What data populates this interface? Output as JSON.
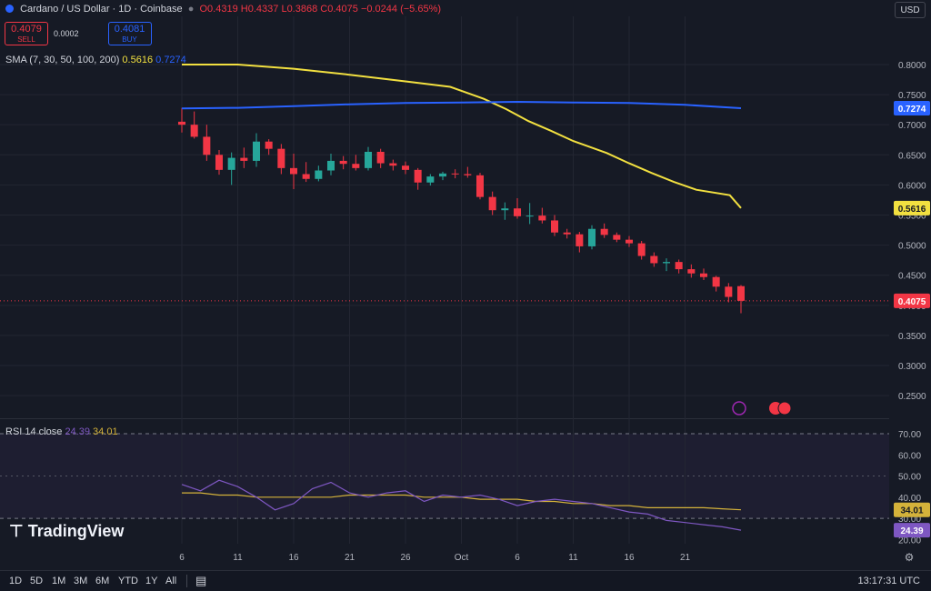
{
  "header": {
    "title": "Cardano / US Dollar · 1D · Coinbase",
    "ohlc_open_label": "O",
    "ohlc_open": "0.4319",
    "ohlc_high_label": "H",
    "ohlc_high": "0.4337",
    "ohlc_low_label": "L",
    "ohlc_low": "0.3868",
    "ohlc_close_label": "C",
    "ohlc_close": "0.4075",
    "change": "−0.0244 (−5.65%)"
  },
  "trade": {
    "sell_price": "0.4079",
    "sell_label": "SELL",
    "spread": "0.0002",
    "buy_price": "0.4081",
    "buy_label": "BUY"
  },
  "currency": "USD",
  "sma_legend": {
    "label": "SMA (7, 30, 50, 100, 200)",
    "v1": "0.5616",
    "v2": "0.7274"
  },
  "rsi_legend": {
    "label": "RSI 14 close",
    "v1": "24.39",
    "v2": "34.01"
  },
  "watermark": "TradingView",
  "bottom": {
    "timeframes": [
      "1D",
      "5D",
      "1M",
      "3M",
      "6M",
      "YTD",
      "1Y",
      "All"
    ],
    "clock": "13:17:31 UTC"
  },
  "colors": {
    "up": "#26a69a",
    "down": "#f23645",
    "sma_short": "#f2e040",
    "sma_long": "#2962ff",
    "rsi": "#7e57c2",
    "rsi_ma": "#d4b23a"
  },
  "chart_data": [
    {
      "type": "candlestick",
      "title": "Cardano / US Dollar · 1D · Coinbase",
      "ylim": [
        0.22,
        0.88
      ],
      "yticks": [
        "0.8000",
        "0.7500",
        "0.7000",
        "0.6500",
        "0.6000",
        "0.5500",
        "0.5000",
        "0.4500",
        "0.4000",
        "0.3500",
        "0.3000",
        "0.2500"
      ],
      "ytick_values": [
        0.8,
        0.75,
        0.7,
        0.65,
        0.6,
        0.55,
        0.5,
        0.45,
        0.4,
        0.35,
        0.3,
        0.25
      ],
      "xlim": [
        0,
        50
      ],
      "xticks": [
        {
          "label": "6",
          "x": 0
        },
        {
          "label": "11",
          "x": 5
        },
        {
          "label": "16",
          "x": 10
        },
        {
          "label": "21",
          "x": 15
        },
        {
          "label": "26",
          "x": 20
        },
        {
          "label": "Oct",
          "x": 25
        },
        {
          "label": "6",
          "x": 30
        },
        {
          "label": "11",
          "x": 35
        },
        {
          "label": "16",
          "x": 40
        },
        {
          "label": "21",
          "x": 45
        }
      ],
      "last_price": "0.4075",
      "last_price_value": 0.4075,
      "sma_short_label": "0.5616",
      "sma_long_label": "0.7274",
      "candles": [
        {
          "o": 0.705,
          "h": 0.728,
          "l": 0.687,
          "c": 0.7
        },
        {
          "o": 0.7,
          "h": 0.722,
          "l": 0.677,
          "c": 0.68
        },
        {
          "o": 0.68,
          "h": 0.7,
          "l": 0.64,
          "c": 0.65
        },
        {
          "o": 0.65,
          "h": 0.658,
          "l": 0.617,
          "c": 0.625
        },
        {
          "o": 0.625,
          "h": 0.654,
          "l": 0.6,
          "c": 0.645
        },
        {
          "o": 0.645,
          "h": 0.662,
          "l": 0.628,
          "c": 0.64
        },
        {
          "o": 0.64,
          "h": 0.686,
          "l": 0.63,
          "c": 0.672
        },
        {
          "o": 0.672,
          "h": 0.676,
          "l": 0.65,
          "c": 0.66
        },
        {
          "o": 0.66,
          "h": 0.668,
          "l": 0.618,
          "c": 0.628
        },
        {
          "o": 0.628,
          "h": 0.652,
          "l": 0.593,
          "c": 0.618
        },
        {
          "o": 0.618,
          "h": 0.638,
          "l": 0.605,
          "c": 0.61
        },
        {
          "o": 0.61,
          "h": 0.632,
          "l": 0.606,
          "c": 0.624
        },
        {
          "o": 0.624,
          "h": 0.652,
          "l": 0.616,
          "c": 0.64
        },
        {
          "o": 0.64,
          "h": 0.648,
          "l": 0.626,
          "c": 0.635
        },
        {
          "o": 0.635,
          "h": 0.65,
          "l": 0.624,
          "c": 0.628
        },
        {
          "o": 0.628,
          "h": 0.663,
          "l": 0.624,
          "c": 0.655
        },
        {
          "o": 0.655,
          "h": 0.66,
          "l": 0.628,
          "c": 0.636
        },
        {
          "o": 0.636,
          "h": 0.642,
          "l": 0.624,
          "c": 0.632
        },
        {
          "o": 0.632,
          "h": 0.639,
          "l": 0.618,
          "c": 0.625
        },
        {
          "o": 0.625,
          "h": 0.628,
          "l": 0.592,
          "c": 0.604
        },
        {
          "o": 0.604,
          "h": 0.618,
          "l": 0.599,
          "c": 0.614
        },
        {
          "o": 0.614,
          "h": 0.622,
          "l": 0.608,
          "c": 0.619
        },
        {
          "o": 0.619,
          "h": 0.626,
          "l": 0.611,
          "c": 0.618
        },
        {
          "o": 0.618,
          "h": 0.63,
          "l": 0.612,
          "c": 0.616
        },
        {
          "o": 0.616,
          "h": 0.62,
          "l": 0.576,
          "c": 0.58
        },
        {
          "o": 0.58,
          "h": 0.589,
          "l": 0.55,
          "c": 0.558
        },
        {
          "o": 0.558,
          "h": 0.571,
          "l": 0.542,
          "c": 0.561
        },
        {
          "o": 0.561,
          "h": 0.578,
          "l": 0.544,
          "c": 0.548
        },
        {
          "o": 0.548,
          "h": 0.57,
          "l": 0.535,
          "c": 0.549
        },
        {
          "o": 0.549,
          "h": 0.562,
          "l": 0.536,
          "c": 0.541
        },
        {
          "o": 0.541,
          "h": 0.55,
          "l": 0.515,
          "c": 0.521
        },
        {
          "o": 0.521,
          "h": 0.527,
          "l": 0.511,
          "c": 0.518
        },
        {
          "o": 0.518,
          "h": 0.522,
          "l": 0.488,
          "c": 0.498
        },
        {
          "o": 0.498,
          "h": 0.533,
          "l": 0.493,
          "c": 0.527
        },
        {
          "o": 0.527,
          "h": 0.536,
          "l": 0.512,
          "c": 0.517
        },
        {
          "o": 0.517,
          "h": 0.521,
          "l": 0.505,
          "c": 0.509
        },
        {
          "o": 0.509,
          "h": 0.515,
          "l": 0.497,
          "c": 0.503
        },
        {
          "o": 0.503,
          "h": 0.507,
          "l": 0.476,
          "c": 0.482
        },
        {
          "o": 0.482,
          "h": 0.488,
          "l": 0.464,
          "c": 0.47
        },
        {
          "o": 0.47,
          "h": 0.478,
          "l": 0.457,
          "c": 0.472
        },
        {
          "o": 0.472,
          "h": 0.476,
          "l": 0.453,
          "c": 0.46
        },
        {
          "o": 0.46,
          "h": 0.468,
          "l": 0.446,
          "c": 0.453
        },
        {
          "o": 0.453,
          "h": 0.461,
          "l": 0.442,
          "c": 0.447
        },
        {
          "o": 0.447,
          "h": 0.449,
          "l": 0.423,
          "c": 0.431
        },
        {
          "o": 0.431,
          "h": 0.437,
          "l": 0.405,
          "c": 0.414
        },
        {
          "o": 0.4319,
          "h": 0.4337,
          "l": 0.3868,
          "c": 0.4075
        }
      ],
      "sma_short": [
        [
          0,
          0.8
        ],
        [
          5,
          0.8
        ],
        [
          10,
          0.793
        ],
        [
          15,
          0.783
        ],
        [
          20,
          0.772
        ],
        [
          24,
          0.763
        ],
        [
          27,
          0.743
        ],
        [
          29,
          0.726
        ],
        [
          31,
          0.706
        ],
        [
          33,
          0.69
        ],
        [
          35,
          0.673
        ],
        [
          38,
          0.653
        ],
        [
          40,
          0.636
        ],
        [
          42,
          0.62
        ],
        [
          44,
          0.605
        ],
        [
          46,
          0.592
        ],
        [
          49,
          0.583
        ],
        [
          50,
          0.5616
        ]
      ],
      "sma_long": [
        [
          0,
          0.727
        ],
        [
          5,
          0.728
        ],
        [
          10,
          0.731
        ],
        [
          15,
          0.734
        ],
        [
          20,
          0.736
        ],
        [
          25,
          0.737
        ],
        [
          30,
          0.738
        ],
        [
          35,
          0.737
        ],
        [
          40,
          0.736
        ],
        [
          45,
          0.733
        ],
        [
          50,
          0.7274
        ]
      ]
    },
    {
      "type": "line",
      "title": "RSI 14 close",
      "ylim": [
        18,
        73
      ],
      "yticks": [
        "70.00",
        "60.00",
        "50.00",
        "40.00",
        "30.00",
        "20.00"
      ],
      "ytick_values": [
        70,
        60,
        50,
        40,
        30,
        20
      ],
      "bands": [
        70,
        30
      ],
      "mid": 50,
      "last_rsi": "24.39",
      "last_ma": "34.01",
      "series": [
        {
          "values": [
            46,
            43,
            48,
            45,
            40,
            34,
            37,
            44,
            47,
            42,
            40,
            42,
            43,
            38,
            41,
            40,
            41,
            39,
            36,
            38,
            39,
            38,
            37,
            35,
            33,
            32,
            29,
            28,
            27,
            26,
            24.39
          ]
        },
        {
          "values": [
            42,
            42,
            41,
            41,
            40,
            40,
            40,
            40,
            40,
            41,
            41,
            41,
            41,
            40,
            40,
            40,
            39,
            39,
            39,
            38,
            38,
            37,
            37,
            36,
            36,
            35,
            35,
            35,
            35,
            34.5,
            34.01
          ]
        }
      ]
    }
  ]
}
